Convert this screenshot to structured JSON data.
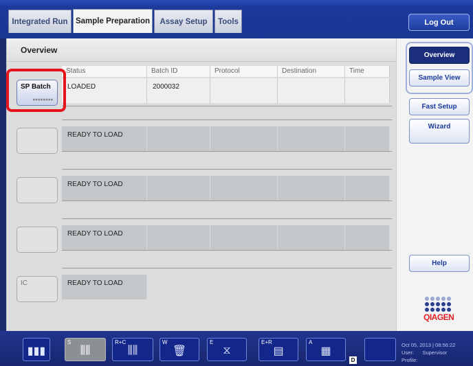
{
  "tabs": [
    {
      "label": "Integrated Run"
    },
    {
      "label": "Sample Preparation"
    },
    {
      "label": "Assay Setup"
    },
    {
      "label": "Tools"
    }
  ],
  "logout_label": "Log Out",
  "overview_title": "Overview",
  "columns": [
    "Status",
    "Batch ID",
    "Protocol",
    "Destination",
    "Time"
  ],
  "rows": [
    {
      "slot_label": "SP Batch",
      "status": "LOADED",
      "batch_id": "2000032",
      "protocol": "",
      "destination": "",
      "time": ""
    },
    {
      "slot_label": "",
      "status": "READY TO LOAD",
      "batch_id": "",
      "protocol": "",
      "destination": "",
      "time": ""
    },
    {
      "slot_label": "",
      "status": "READY TO LOAD",
      "batch_id": "",
      "protocol": "",
      "destination": "",
      "time": ""
    },
    {
      "slot_label": "",
      "status": "READY TO LOAD",
      "batch_id": "",
      "protocol": "",
      "destination": "",
      "time": ""
    },
    {
      "slot_label": "IC",
      "status": "READY TO LOAD"
    }
  ],
  "side_buttons": {
    "overview": "Overview",
    "sample_view": "Sample View",
    "fast_setup": "Fast Setup",
    "wizard": "Wizard",
    "help": "Help"
  },
  "logo_text": "QIAGEN",
  "drawer_buttons": [
    {
      "key": "",
      "icon": "tube-rack-icon"
    },
    {
      "key": "S",
      "icon": "sample-tubes-icon"
    },
    {
      "key": "R+C",
      "icon": "reagent-cartridge-icon"
    },
    {
      "key": "W",
      "icon": "waste-bin-icon"
    },
    {
      "key": "E",
      "icon": "eluate-icon"
    },
    {
      "key": "E+R",
      "icon": "eluate-reagent-icon"
    },
    {
      "key": "A",
      "icon": "assay-plate-icon"
    },
    {
      "key": "",
      "icon": "blank-icon"
    }
  ],
  "drawer_badge": "D",
  "status": {
    "datetime": "Oct 05, 2013 | 08:56:22",
    "user_label": "User:",
    "user": "Supervisor",
    "profile_label": "Profile:"
  },
  "colors": {
    "accent": "#1c3a9c",
    "highlight": "#e5141c",
    "brand": "#e01e26"
  }
}
